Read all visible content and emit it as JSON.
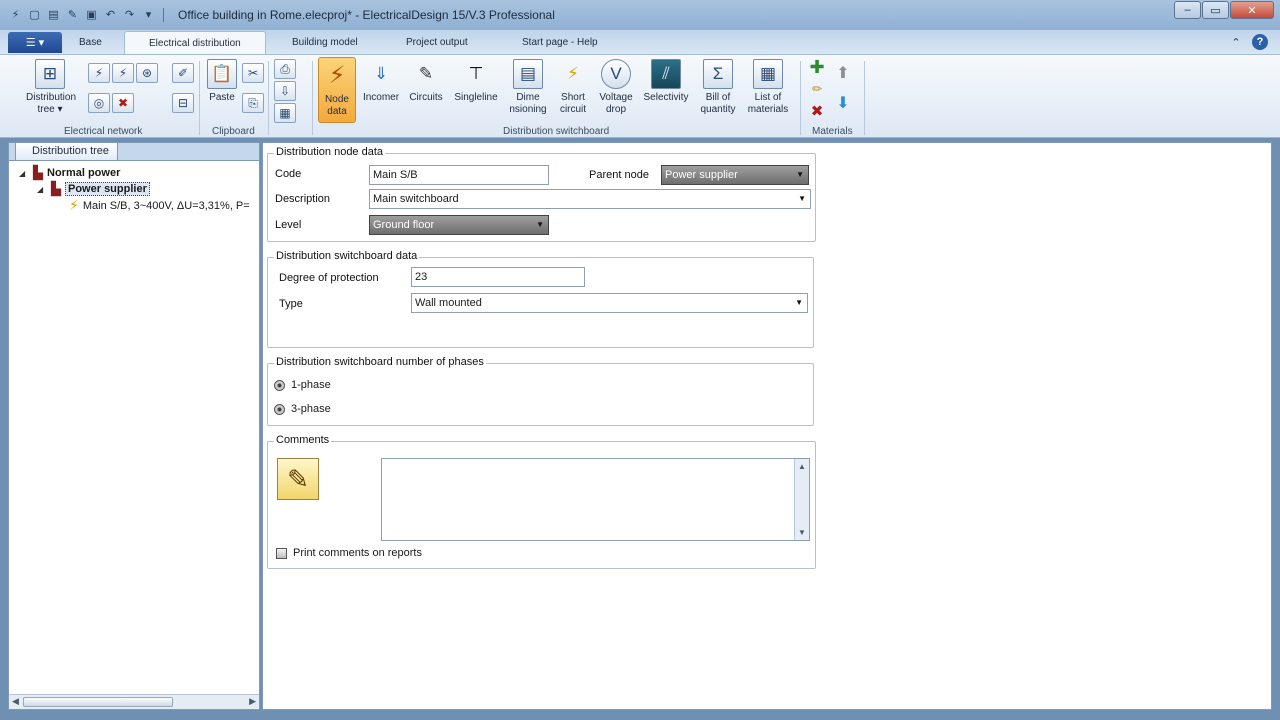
{
  "window": {
    "title": "Office building in Rome.elecproj* - ElectricalDesign 15/V.3 Professional"
  },
  "tabs": {
    "app_menu_label": "☰ ▾",
    "items": [
      "Base",
      "Electrical distribution",
      "Building model",
      "Project output",
      "Start page - Help"
    ],
    "active": "Electrical distribution"
  },
  "ribbon": {
    "distribution_tree": "Distribution tree ▾",
    "paste": "Paste",
    "node_data": "Node data",
    "incomer": "Incomer",
    "circuits": "Circuits",
    "singleline": "Singleline",
    "dimensioning": "Dime nsioning",
    "short_circuit": "Short circuit",
    "voltage_drop": "Voltage drop",
    "selectivity": "Selectivity",
    "bill_of_quantity": "Bill of quantity",
    "list_of_materials": "List of materials",
    "groups": {
      "electrical_network": "Electrical network",
      "clipboard": "Clipboard",
      "distribution_switchboard": "Distribution switchboard",
      "materials": "Materials"
    }
  },
  "tree": {
    "tab_label": "Distribution tree",
    "root": "Normal power",
    "supplier": "Power supplier",
    "main": "Main S/B, 3~400V, ΔU=3,31%, P="
  },
  "node_data": {
    "legend": "Distribution node data",
    "code_label": "Code",
    "code_value": "Main S/B",
    "parent_label": "Parent node",
    "parent_value": "Power supplier",
    "description_label": "Description",
    "description_value": "Main switchboard",
    "level_label": "Level",
    "level_value": "Ground floor"
  },
  "switchboard": {
    "legend": "Distribution switchboard data",
    "protection_label": "Degree of protection",
    "protection_value": "23",
    "type_label": "Type",
    "type_value": "Wall mounted"
  },
  "phases": {
    "legend": "Distribution switchboard number of phases",
    "one_phase": "1-phase",
    "three_phase": "3-phase"
  },
  "comments": {
    "legend": "Comments",
    "print_label": "Print comments on reports"
  }
}
